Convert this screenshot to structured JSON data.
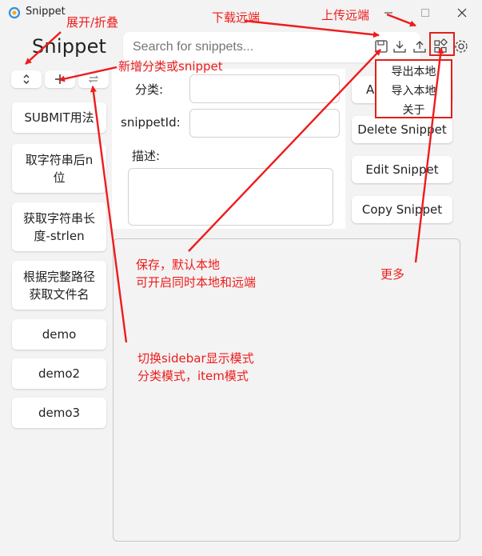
{
  "window": {
    "title": "Snippet"
  },
  "brand": "Snippet",
  "search": {
    "placeholder": "Search for snippets..."
  },
  "toolbar_icons": [
    "save-icon",
    "download-icon",
    "upload-icon",
    "apps-grid-icon",
    "settings-gear-icon"
  ],
  "sidebar": {
    "controls": {
      "toggle": "⌃⌄",
      "add": "+",
      "switch": "⇄"
    },
    "items": [
      "SUBMIT用法",
      "取字符串后n位",
      "获取字符串长度-strlen",
      "根据完整路径获取文件名",
      "demo",
      "demo2",
      "demo3"
    ]
  },
  "form": {
    "category_label": "分类:",
    "snippet_id_label": "snippetId:",
    "description_label": "描述:"
  },
  "actions": {
    "add_label": "A",
    "delete_label": "Delete Snippet",
    "edit_label": "Edit Snippet",
    "copy_label": "Copy Snippet"
  },
  "more_menu": {
    "items": [
      "导出本地",
      "导入本地",
      "关于"
    ]
  },
  "annotations": {
    "expand_collapse": "展开/折叠",
    "add_category": "新增分类或snippet",
    "download_remote": "下载远端",
    "upload_remote": "上传远端",
    "save_line1": "保存，默认本地",
    "save_line2": "可开启同时本地和远端",
    "more": "更多",
    "switch_line1": "切换sidebar显示模式",
    "switch_line2": "分类模式，item模式"
  },
  "colors": {
    "annotation": "#ee1c1c",
    "background": "#f3f3f3"
  }
}
